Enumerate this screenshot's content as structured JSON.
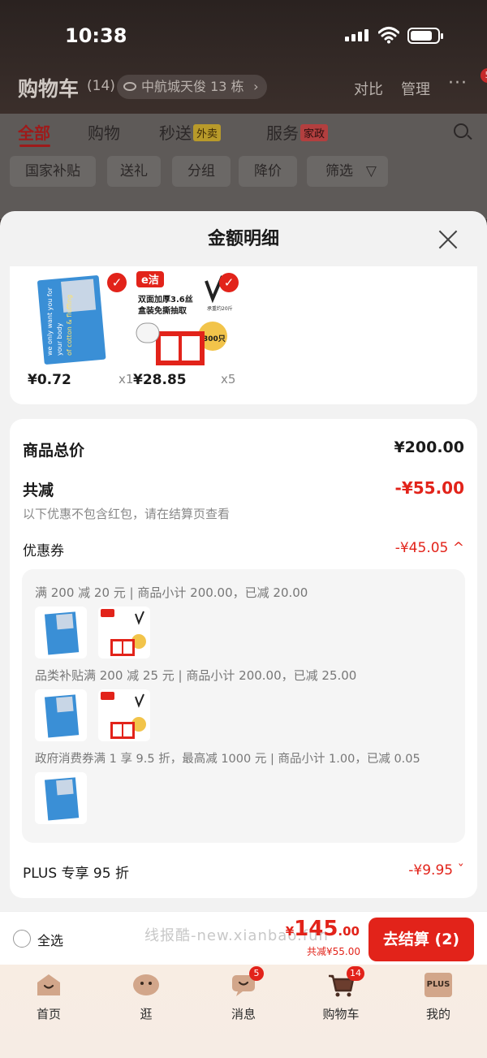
{
  "status_bar": {
    "time": "10:38"
  },
  "cart_header": {
    "title": "购物车",
    "count": "(14)",
    "address": "中航城天俊 13 栋",
    "compare": "对比",
    "manage": "管理",
    "more_badge": "5"
  },
  "tabs": [
    {
      "label": "全部"
    },
    {
      "label": "购物"
    },
    {
      "label": "秒送",
      "tag": "外卖"
    },
    {
      "label": "服务",
      "tag": "家政"
    }
  ],
  "chips": [
    "国家补贴",
    "送礼",
    "分组",
    "降价",
    "筛选"
  ],
  "sheet": {
    "title": "金额明细",
    "items": [
      {
        "name": "blue pack",
        "price": "¥0.72",
        "qty": "x1"
      },
      {
        "name": "e洁 bags",
        "price": "¥28.85",
        "qty": "x5"
      }
    ],
    "product_brand_text": "e洁",
    "product_desc": "双面加厚3.6丝",
    "product_desc2": "盒装免撕抽取",
    "product_badge": "300只",
    "product_side": "承重约20斤",
    "summary": {
      "total_label": "商品总价",
      "total_value": "¥200.00",
      "discount_label": "共减",
      "discount_value": "-¥55.00",
      "note": "以下优惠不包含红包，请在结算页查看",
      "coupon_label": "优惠券",
      "coupon_value": "-¥45.05 ^",
      "coupon_lines": [
        "满 200 减 20 元 | 商品小计 200.00，已减 20.00",
        "品类补贴满 200 减 25 元 | 商品小计 200.00，已减 25.00",
        "政府消费券满 1 享 9.5 折，最高减 1000 元 | 商品小计 1.00，已减 0.05"
      ],
      "plus_label": "PLUS 专享 95 折",
      "plus_value": "-¥9.95 ˇ"
    }
  },
  "checkout_bar": {
    "select_all": "全选",
    "watermark": "线报酷-new.xianbao.fun",
    "total_prefix": "¥",
    "total_main": "145",
    "total_decimal": ".00",
    "saving": "共减¥55.00",
    "checkout_button": "去结算 (2)"
  },
  "tabbar": [
    {
      "label": "首页"
    },
    {
      "label": "逛"
    },
    {
      "label": "消息",
      "badge": "5"
    },
    {
      "label": "购物车",
      "badge": "14"
    },
    {
      "label": "我的",
      "icon_text": "PLUS"
    }
  ],
  "colors": {
    "accent": "#e2231a",
    "overlay": "#3a3230",
    "sheet_bg": "#f2f2f2"
  }
}
